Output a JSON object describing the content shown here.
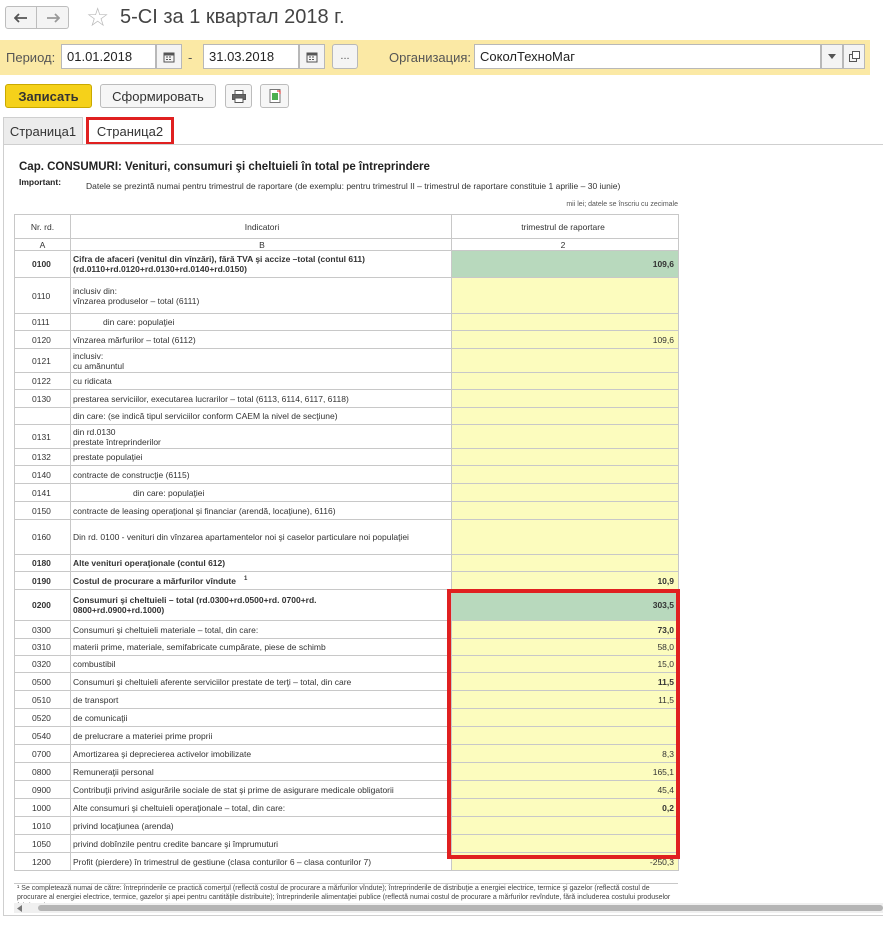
{
  "window": {
    "title": "5-CI  за 1 квартал 2018 г."
  },
  "period": {
    "label": "Период:",
    "from": "01.01.2018",
    "separator": "-",
    "to": "31.03.2018",
    "ellipsis": "...",
    "org_label": "Организация:",
    "org_value": "СоколТехноМаг"
  },
  "toolbar": {
    "save": "Записать",
    "generate": "Сформировать"
  },
  "tabs": [
    {
      "label": "Страница1"
    },
    {
      "label": "Страница2"
    }
  ],
  "section": {
    "title": "Cap. CONSUMURI: Venituri, consumuri şi cheltuieli în total pe întreprindere",
    "important_label": "Important:",
    "important_text": "Datele se prezintă numai pentru trimestrul de raportare (de exemplu: pentru trimestrul II – trimestrul de raportare constituie 1 aprilie – 30 iunie)",
    "unit_note": "mii lei; datele se înscriu cu zecimale"
  },
  "table": {
    "headers": {
      "code": "Nr. rd.",
      "indicator": "Indicatori",
      "value": "trimestrul de raportare"
    },
    "letters": {
      "code": "A",
      "indicator": "B",
      "value": "2"
    },
    "rows": [
      {
        "code": "0100",
        "line1": "Cifra de afaceri (venitul din vînzări), fără TVA şi accize –total (contul 611)",
        "line2": "(rd.0110+rd.0120+rd.0130+rd.0140+rd.0150)",
        "value": "109,6"
      },
      {
        "code": "0110",
        "line1": "inclusiv din:",
        "line2": "vînzarea produselor – total (6111)",
        "value": ""
      },
      {
        "code": "0111",
        "line1": "din care: populaţiei",
        "value": ""
      },
      {
        "code": "0120",
        "line1": "vînzarea mărfurilor – total (6112)",
        "value": "109,6"
      },
      {
        "code": "0121",
        "line1": "inclusiv:",
        "line2": "cu amănuntul",
        "value": ""
      },
      {
        "code": "0122",
        "line1": "cu ridicata",
        "value": ""
      },
      {
        "code": "0130",
        "line1": "prestarea serviciilor, executarea lucrarilor – total (6113, 6114, 6117, 6118)",
        "value": ""
      },
      {
        "code": "",
        "line1": "din care: (se indică tipul serviciilor conform CAEM la nivel de secţiune)",
        "value": ""
      },
      {
        "code": "0131",
        "line1": "din rd.0130",
        "line2": "prestate întreprinderilor",
        "value": ""
      },
      {
        "code": "0132",
        "line1": "prestate populaţiei",
        "value": ""
      },
      {
        "code": "0140",
        "line1": "contracte de construcţie (6115)",
        "value": ""
      },
      {
        "code": "0141",
        "line1": "din care: populaţiei",
        "value": ""
      },
      {
        "code": "0150",
        "line1": "contracte de leasing operaţional şi financiar (arendă, locaţiune), 6116)",
        "value": ""
      },
      {
        "code": "0160",
        "line1": "Din rd. 0100 - venituri din vînzarea apartamentelor noi şi caselor particulare noi  populaţiei",
        "value": ""
      },
      {
        "code": "0180",
        "line1": "Alte venituri operaţionale (contul 612)",
        "value": ""
      },
      {
        "code": "0190",
        "line1": "Costul de procurare a mărfurilor vîndute",
        "superscript": "1",
        "value": "10,9"
      },
      {
        "code": "0200",
        "line1": "Consumuri şi cheltuieli – total (rd.0300+rd.0500+rd. 0700+rd.",
        "line2": "0800+rd.0900+rd.1000)",
        "value": "303,5"
      },
      {
        "code": "0300",
        "line1": "Consumuri şi cheltuieli materiale – total, din care:",
        "value": "73,0"
      },
      {
        "code": "0310",
        "line1": "materii prime, materiale, semifabricate cumpărate, piese de schimb",
        "value": "58,0"
      },
      {
        "code": "0320",
        "line1": "combustibil",
        "value": "15,0"
      },
      {
        "code": "0500",
        "line1": "Consumuri şi cheltuieli aferente serviciilor prestate de terţi – total, din care",
        "value": "11,5"
      },
      {
        "code": "0510",
        "line1": "de transport",
        "value": "11,5"
      },
      {
        "code": "0520",
        "line1": "de comunicaţii",
        "value": ""
      },
      {
        "code": "0540",
        "line1": "de prelucrare a materiei prime proprii",
        "value": ""
      },
      {
        "code": "0700",
        "line1": "Amortizarea şi deprecierea activelor imobilizate",
        "value": "8,3"
      },
      {
        "code": "0800",
        "line1": "Remuneraţii personal",
        "value": "165,1"
      },
      {
        "code": "0900",
        "line1": "Contribuţii privind asigurările sociale de stat şi prime de asigurare medicale obligatorii",
        "value": "45,4"
      },
      {
        "code": "1000",
        "line1": "Alte consumuri şi cheltuieli operaţionale – total, din care:",
        "value": "0,2"
      },
      {
        "code": "1010",
        "line1": "privind locaţiunea (arenda)",
        "value": ""
      },
      {
        "code": "1050",
        "line1": "privind dobînzile pentru credite bancare şi împrumuturi",
        "value": ""
      },
      {
        "code": "1200",
        "line1": "Profit (pierdere) în trimestrul de gestiune (clasa conturilor 6 – clasa conturilor 7)",
        "value": "-250,3"
      }
    ]
  },
  "footnote": "¹ Se completează numai de către: întreprinderile ce practică comerţul (reflectă costul de procurare a mărfurilor vîndute); întreprinderile de distribuţie a energiei electrice, termice şi gazelor (reflectă costul de procurare al energiei electrice, termice, gazelor şi apei pentru cantităţile distribuite); întreprinderile alimentaţiei publice (reflectă numai costul de procurare a mărfurilor revîndute, fără includerea costului produselor fabricate)",
  "colors": {
    "accent": "#f5d11a",
    "period_bg": "#fbe9a5",
    "input_cell": "#fcfcbe",
    "total_cell": "#b8d9bd",
    "highlight": "#e02020"
  }
}
